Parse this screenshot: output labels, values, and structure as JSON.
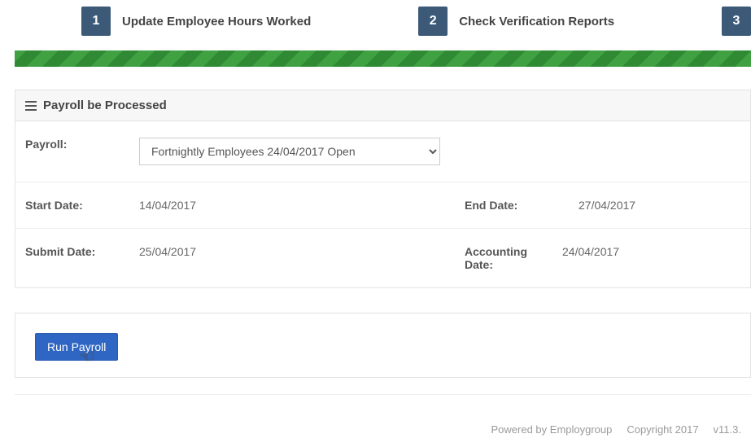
{
  "steps": [
    {
      "num": "1",
      "label": "Update Employee Hours Worked"
    },
    {
      "num": "2",
      "label": "Check Verification Reports"
    },
    {
      "num": "3",
      "label": ""
    }
  ],
  "panel": {
    "title": "Payroll be Processed",
    "payroll_label": "Payroll:",
    "payroll_selected": "Fortnightly Employees 24/04/2017 Open",
    "start_date_label": "Start Date:",
    "start_date_value": "14/04/2017",
    "end_date_label": "End Date:",
    "end_date_value": "27/04/2017",
    "submit_date_label": "Submit Date:",
    "submit_date_value": "25/04/2017",
    "accounting_date_label": "Accounting Date:",
    "accounting_date_value": "24/04/2017"
  },
  "actions": {
    "run_payroll": "Run Payroll"
  },
  "footer": {
    "powered": "Powered by Employgroup",
    "copyright": "Copyright 2017",
    "version": "v11.3."
  }
}
